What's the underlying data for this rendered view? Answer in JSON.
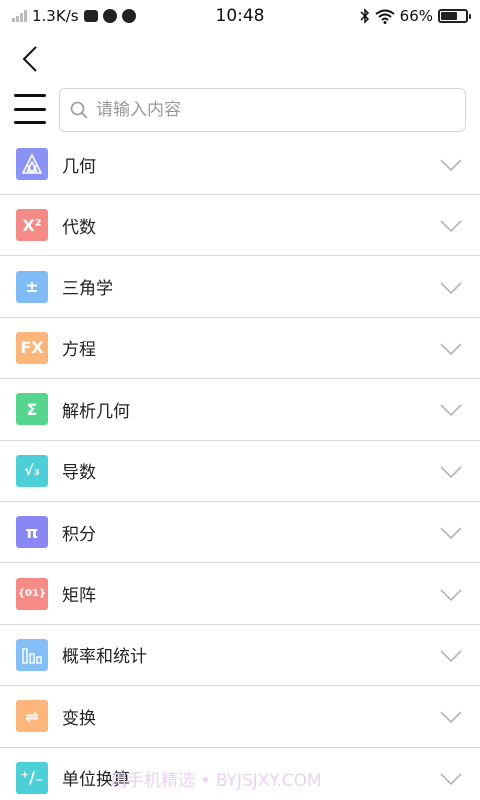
{
  "status_bar": {
    "speed": "1.3K/s",
    "time": "10:48",
    "battery": "66%",
    "battery_level": 0.66
  },
  "search": {
    "placeholder": "请输入内容"
  },
  "categories": [
    {
      "label": "几何",
      "icon": "triangles-icon",
      "icon_text": "",
      "color": "#8a92f5"
    },
    {
      "label": "代数",
      "icon": "x-squared-icon",
      "icon_text": "X²",
      "color": "#f58a86"
    },
    {
      "label": "三角学",
      "icon": "plus-minus-icon",
      "icon_text": "±",
      "color": "#7fbcf6"
    },
    {
      "label": "方程",
      "icon": "fx-icon",
      "icon_text": "FX",
      "color": "#fcb67c"
    },
    {
      "label": "解析几何",
      "icon": "sigma-icon",
      "icon_text": "Σ",
      "color": "#56d58f"
    },
    {
      "label": "导数",
      "icon": "sqrt-icon",
      "icon_text": "√₃",
      "color": "#4dcfd8"
    },
    {
      "label": "积分",
      "icon": "pi-icon",
      "icon_text": "π",
      "color": "#8a86f3"
    },
    {
      "label": "矩阵",
      "icon": "matrix-icon",
      "icon_text": "{01}",
      "color": "#f58a86"
    },
    {
      "label": "概率和统计",
      "icon": "bar-chart-icon",
      "icon_text": "",
      "color": "#84bef6"
    },
    {
      "label": "变换",
      "icon": "swap-arrows-icon",
      "icon_text": "⇌",
      "color": "#fcb67c"
    },
    {
      "label": "单位换算",
      "icon": "plus-minus-slash-icon",
      "icon_text": "⁺∕₋",
      "color": "#4dcfd8"
    }
  ],
  "watermark": "用手机精选 • BYJSJXY.COM"
}
